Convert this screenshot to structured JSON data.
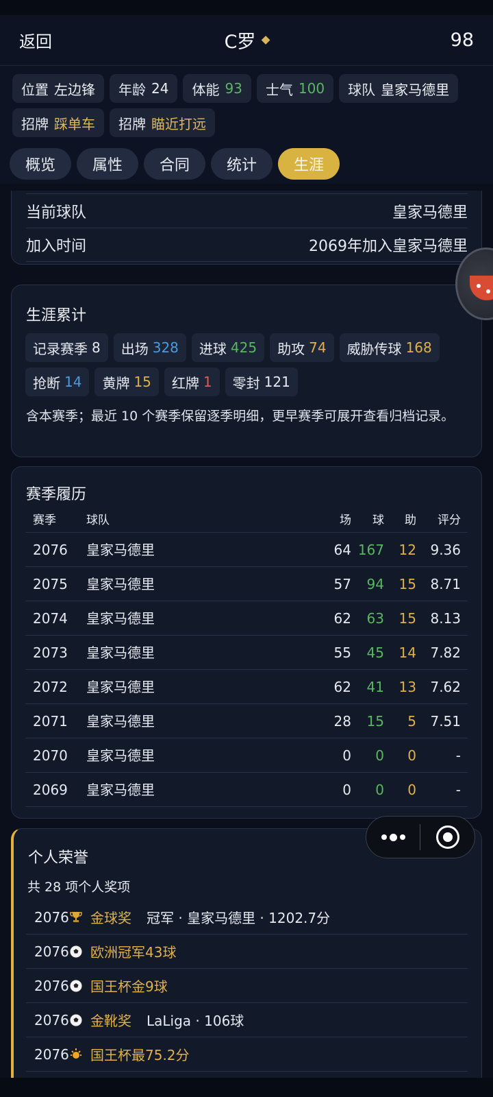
{
  "header": {
    "back_label": "返回",
    "title": "C罗",
    "rating": "98"
  },
  "attributes": [
    {
      "label": "位置",
      "value": "左边锋",
      "tone": "white"
    },
    {
      "label": "年龄",
      "value": "24",
      "tone": "white"
    },
    {
      "label": "体能",
      "value": "93",
      "tone": "green"
    },
    {
      "label": "士气",
      "value": "100",
      "tone": "green"
    },
    {
      "label": "球队",
      "value": "皇家马德里",
      "tone": "white"
    },
    {
      "label": "招牌",
      "value": "踩单车",
      "tone": "gold"
    },
    {
      "label": "招牌",
      "value": "瞄近打远",
      "tone": "gold"
    }
  ],
  "tabs": [
    {
      "label": "概览",
      "active": false
    },
    {
      "label": "属性",
      "active": false
    },
    {
      "label": "合同",
      "active": false
    },
    {
      "label": "统计",
      "active": false
    },
    {
      "label": "生涯",
      "active": true
    }
  ],
  "club_info": {
    "current_team_label": "当前球队",
    "current_team_value": "皇家马德里",
    "join_time_label": "加入时间",
    "join_time_value": "2069年加入皇家马德里"
  },
  "career_totals": {
    "title": "生涯累计",
    "stats": [
      {
        "label": "记录赛季",
        "value": "8",
        "tone": "white"
      },
      {
        "label": "出场",
        "value": "328",
        "tone": "blue"
      },
      {
        "label": "进球",
        "value": "425",
        "tone": "green"
      },
      {
        "label": "助攻",
        "value": "74",
        "tone": "gold"
      },
      {
        "label": "威胁传球",
        "value": "168",
        "tone": "gold"
      },
      {
        "label": "抢断",
        "value": "14",
        "tone": "blue"
      },
      {
        "label": "黄牌",
        "value": "15",
        "tone": "gold"
      },
      {
        "label": "红牌",
        "value": "1",
        "tone": "red"
      },
      {
        "label": "零封",
        "value": "121",
        "tone": "white"
      }
    ],
    "note": "含本赛季；最近 10 个赛季保留逐季明细，更早赛季可展开查看归档记录。"
  },
  "season_history": {
    "title": "赛季履历",
    "columns": {
      "season": "赛季",
      "team": "球队",
      "apps": "场",
      "goals": "球",
      "assists": "助",
      "rating": "评分"
    },
    "rows": [
      {
        "season": "2076",
        "team": "皇家马德里",
        "apps": "64",
        "goals": "167",
        "assists": "12",
        "rating": "9.36"
      },
      {
        "season": "2075",
        "team": "皇家马德里",
        "apps": "57",
        "goals": "94",
        "assists": "15",
        "rating": "8.71"
      },
      {
        "season": "2074",
        "team": "皇家马德里",
        "apps": "62",
        "goals": "63",
        "assists": "15",
        "rating": "8.13"
      },
      {
        "season": "2073",
        "team": "皇家马德里",
        "apps": "55",
        "goals": "45",
        "assists": "14",
        "rating": "7.82"
      },
      {
        "season": "2072",
        "team": "皇家马德里",
        "apps": "62",
        "goals": "41",
        "assists": "13",
        "rating": "7.62"
      },
      {
        "season": "2071",
        "team": "皇家马德里",
        "apps": "28",
        "goals": "15",
        "assists": "5",
        "rating": "7.51"
      },
      {
        "season": "2070",
        "team": "皇家马德里",
        "apps": "0",
        "goals": "0",
        "assists": "0",
        "rating": "-"
      },
      {
        "season": "2069",
        "team": "皇家马德里",
        "apps": "0",
        "goals": "0",
        "assists": "0",
        "rating": "-"
      }
    ]
  },
  "honors": {
    "title": "个人荣誉",
    "count_text": "共 28 项个人奖项",
    "items": [
      {
        "year": "2076",
        "icon": "trophy-icon",
        "name": "金球奖",
        "detail": "冠军 · 皇家马德里 · 1202.7分"
      },
      {
        "year": "2076",
        "icon": "soccer-ball-icon",
        "name": "欧洲冠军43球",
        "detail": ""
      },
      {
        "year": "2076",
        "icon": "soccer-ball-icon",
        "name": "国王杯金9球",
        "detail": ""
      },
      {
        "year": "2076",
        "icon": "soccer-ball-icon",
        "name": "金靴奖",
        "detail": "LaLiga · 106球"
      },
      {
        "year": "2076",
        "icon": "star-icon",
        "name": "国王杯最75.2分",
        "detail": ""
      }
    ]
  },
  "colors": {
    "accent_gold": "#d9b341",
    "green": "#58b85f",
    "blue": "#4a9be0",
    "red": "#e35a4f",
    "background": "#0a0f1b"
  }
}
